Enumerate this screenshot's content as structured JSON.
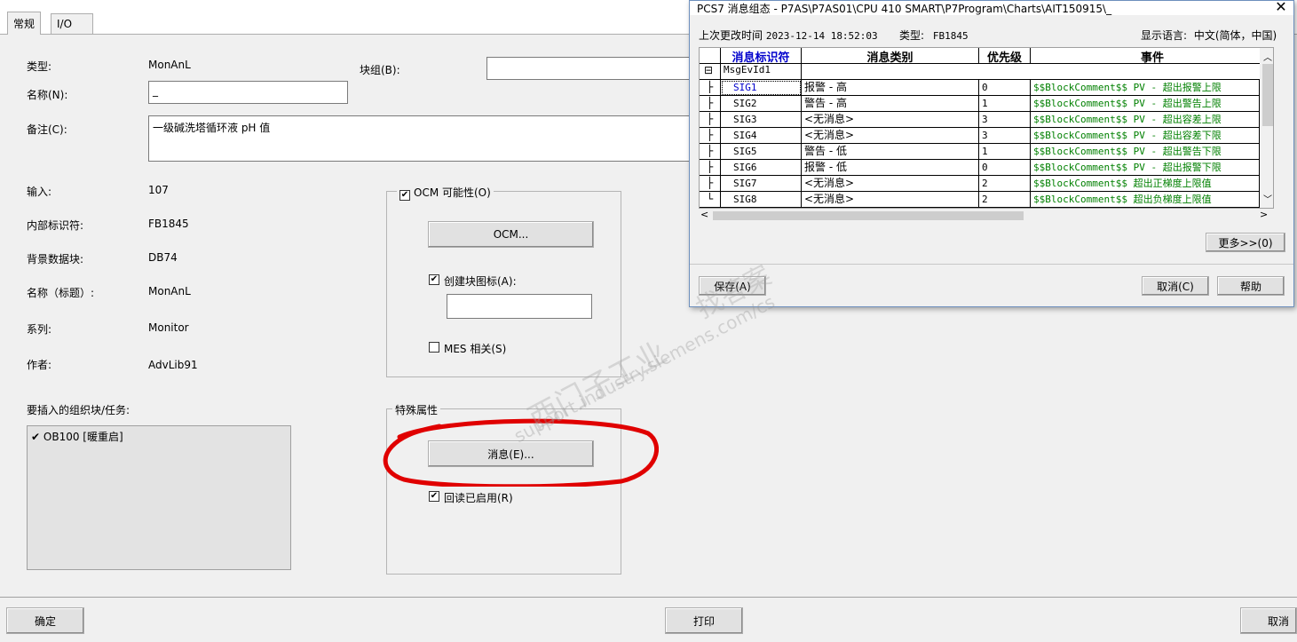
{
  "tabs": [
    "常规",
    "I/O"
  ],
  "left": {
    "type_label": "类型:",
    "type_value": "MonAnL",
    "name_label": "名称(N):",
    "name_value": "_",
    "comment_label": "备注(C):",
    "comment_value": "一级碱洗塔循环液 pH 值",
    "blockgroup_label": "块组(B):",
    "input_label": "输入:",
    "input_value": "107",
    "internal_id_label": "内部标识符:",
    "internal_id_value": "FB1845",
    "idb_label": "背景数据块:",
    "idb_value": "DB74",
    "title_label": "名称（标题）:",
    "title_value": "MonAnL",
    "family_label": "系列:",
    "family_value": "Monitor",
    "author_label": "作者:",
    "author_value": "AdvLib91",
    "ob_label": "要插入的组织块/任务:",
    "ob_item": "OB100 [暖重启]",
    "ocm_group": "OCM 可能性(O)",
    "ocm_button": "OCM...",
    "create_icon_label": "创建块图标(A):",
    "mes_label": "MES 相关(S)",
    "special_group": "特殊属性",
    "msg_button": "消息(E)...",
    "readback_label": "回读已启用(R)",
    "ok_button": "确定",
    "print_button": "打印",
    "cancel_button": "取消"
  },
  "dialog": {
    "title": "PCS7 消息组态 - P7AS\\P7AS01\\CPU 410 SMART\\P7Program\\Charts\\AIT150915\\_",
    "last_changed_label": "上次更改时间",
    "last_changed_value": "2023-12-14 18:52:03",
    "type_label": "类型:",
    "type_value": "FB1845",
    "lang_label": "显示语言:",
    "lang_value": "中文(简体，中国)",
    "headers": [
      "消息标识符",
      "消息类别",
      "优先级",
      "事件"
    ],
    "group_name": "MsgEvId1",
    "rows": [
      {
        "id": "SIG1",
        "cat": "报警 - 高",
        "prio": "0",
        "event": "$$BlockComment$$ PV - 超出报警上限"
      },
      {
        "id": "SIG2",
        "cat": "警告 - 高",
        "prio": "1",
        "event": "$$BlockComment$$ PV - 超出警告上限"
      },
      {
        "id": "SIG3",
        "cat": "<无消息>",
        "prio": "3",
        "event": "$$BlockComment$$ PV - 超出容差上限"
      },
      {
        "id": "SIG4",
        "cat": "<无消息>",
        "prio": "3",
        "event": "$$BlockComment$$ PV - 超出容差下限"
      },
      {
        "id": "SIG5",
        "cat": "警告 - 低",
        "prio": "1",
        "event": "$$BlockComment$$ PV - 超出警告下限"
      },
      {
        "id": "SIG6",
        "cat": "报警 - 低",
        "prio": "0",
        "event": "$$BlockComment$$ PV - 超出报警下限"
      },
      {
        "id": "SIG7",
        "cat": "<无消息>",
        "prio": "2",
        "event": "$$BlockComment$$ 超出正梯度上限值"
      },
      {
        "id": "SIG8",
        "cat": "<无消息>",
        "prio": "2",
        "event": "$$BlockComment$$ 超出负梯度上限值"
      }
    ],
    "more_button": "更多>>(0)",
    "save_button": "保存(A)",
    "cancel_button": "取消(C)",
    "help_button": "帮助"
  },
  "watermark": {
    "line1": "西门子工业",
    "line2": "support.industry.siemens.com/cs",
    "line3": "找答案"
  },
  "colors": {
    "event_text": "#008000",
    "selected_id": "#0000cc",
    "highlight_circle": "#e00000"
  }
}
